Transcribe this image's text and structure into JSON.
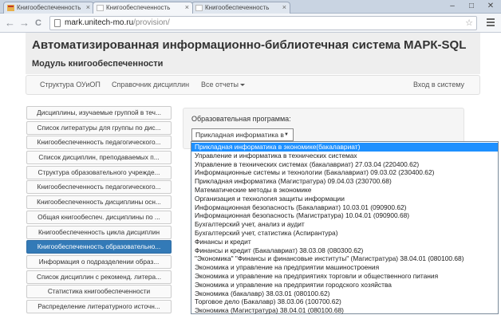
{
  "browser": {
    "tabs": [
      {
        "title": "Книгообеспеченность",
        "active": false
      },
      {
        "title": "Книгообеспеченность",
        "active": true
      },
      {
        "title": "Книгообеспеченность",
        "active": false
      }
    ],
    "url_host": "mark.unitech-mo.ru",
    "url_path": "/provision/",
    "window_controls": {
      "minimize": "–",
      "maximize": "□",
      "close": "✕"
    },
    "nav": {
      "back": "←",
      "forward": "→",
      "reload": "C",
      "star": "☆",
      "tab_close": "×"
    }
  },
  "header": {
    "title": "Автоматизированная информационно-библиотечная система МАРК-SQL",
    "subtitle": "Модуль книгообеспеченности"
  },
  "navbar": {
    "items": [
      "Структура ОУиОП",
      "Справочник дисциплин",
      "Все отчеты"
    ],
    "login": "Вход в систему"
  },
  "sidebar": {
    "active_index": 10,
    "items": [
      "Дисциплины, изучаемые группой в теч...",
      "Список литературы для группы по дис...",
      "Книгообеспеченность педагогического...",
      "Список дисциплин, преподаваемых п...",
      "Структура образовательного учрежде...",
      "Книгообеспеченность педагогического...",
      "Книгообеспеченность дисциплины осн...",
      "Общая книгообеспеч. дисциплины по ...",
      "Книгообеспеченность цикла дисциплин",
      "Книгообеспеченность образовательно...",
      "Информация о подразделении образ...",
      "Список дисциплин с рекоменд. литера...",
      "Статистика книгообеспеченности",
      "Распределение литературного источн..."
    ]
  },
  "form": {
    "label": "Образовательная программа:",
    "selected_value": "Прикладная информатика в",
    "arrow": "▼"
  },
  "dropdown": {
    "selected_index": 0,
    "options": [
      "Прикладная информатика в экономике(бакалавриат)",
      "Управление и информатика в технических системах",
      "Управление в технических системах (бакалавриат) 27.03.04 (220400.62)",
      "Информационные системы и технологии (Бакалавриат) 09.03.02 (230400.62)",
      "Прикладная информатика (Магистратура) 09.04.03 (230700.68)",
      "Математические методы в экономике",
      "Организация и технология защиты информации",
      "Информационная безопасность (Бакалавриат) 10.03.01 (090900.62)",
      "Информационная безопасность (Магистратура) 10.04.01 (090900.68)",
      "Бухгалтерский учет, анализ и аудит",
      "Бухгалтерский учет, статистика (Аспирантура)",
      "Финансы и кредит",
      "Финансы и кредит (Бакалавриат) 38.03.08 (080300.62)",
      "\"Экономика\" \"Финансы и финансовые институты\" (Магистратура) 38.04.01 (080100.68)",
      "Экономика и управление на предприятии машиностроения",
      "Экономика и управление на предприятиях торговли и общественного питания",
      "Экономика и управление на предприятии городского хозяйства",
      "Экономика (бакалавр) 38.03.01 (080100.62)",
      "Торговое дело (Бакалавр) 38.03.06 (100700.62)",
      "Экономика (Магистратура) 38.04.01 (080100.68)"
    ]
  },
  "colors": {
    "active": "#337ab7",
    "selected_option": "#1e90ff"
  }
}
